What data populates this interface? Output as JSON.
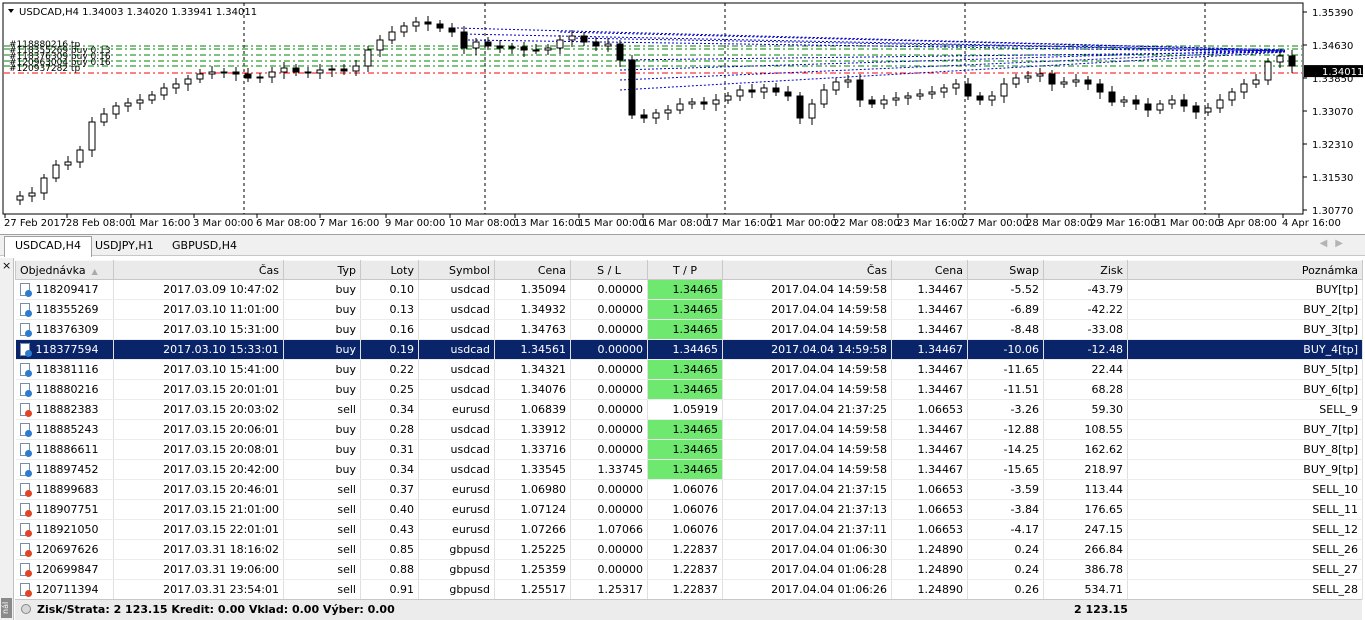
{
  "chart": {
    "header": "USDCAD,H4  1.34003 1.34020 1.33941 1.34011",
    "price_labels": [
      "1.35390",
      "1.34630",
      "1.33850",
      "1.33070",
      "1.32310",
      "1.31530",
      "1.30770"
    ],
    "current_price": "1.34011",
    "time_labels": [
      "27 Feb 2017",
      "28 Feb 08:00",
      "1 Mar 16:00",
      "3 Mar 00:00",
      "6 Mar 08:00",
      "7 Mar 16:00",
      "9 Mar 00:00",
      "10 Mar 08:00",
      "13 Mar 16:00",
      "15 Mar 00:00",
      "16 Mar 08:00",
      "17 Mar 16:00",
      "21 Mar 00:00",
      "22 Mar 08:00",
      "23 Mar 16:00",
      "27 Mar 00:00",
      "28 Mar 08:00",
      "29 Mar 16:00",
      "31 Mar 00:00",
      "3 Apr 08:00",
      "4 Apr 16:00"
    ],
    "order_labels": [
      "#118880216 tp",
      "#118355269 buy 0.13",
      "#118376309 buy 0.16",
      "#120963004 buy 0.16",
      "#120937282 tp"
    ],
    "colors": {
      "bull": "#ffffff",
      "bear": "#000000",
      "tp_line": "#008000",
      "entry_line": "#ff0000",
      "connector": "#0000cc",
      "grid": "#000000"
    }
  },
  "tabs": [
    {
      "label": "USDCAD,H4",
      "active": true
    },
    {
      "label": "USDJPY,H1",
      "active": false
    },
    {
      "label": "GBPUSD,H4",
      "active": false
    }
  ],
  "side": {
    "close": "×",
    "label": "nál"
  },
  "table": {
    "columns": [
      "Objednávka",
      "Čas",
      "Typ",
      "Loty",
      "Symbol",
      "Cena",
      "S / L",
      "T / P",
      "Čas",
      "Cena",
      "Swap",
      "Zisk",
      "Poznámka"
    ],
    "rows": [
      {
        "order": "118209417",
        "open_time": "2017.03.09 10:47:02",
        "type": "buy",
        "lots": "0.10",
        "symbol": "usdcad",
        "open_price": "1.35094",
        "sl": "0.00000",
        "tp": "1.34465",
        "close_time": "2017.04.04 14:59:58",
        "close_price": "1.34467",
        "swap": "-5.52",
        "profit": "-43.79",
        "comment": "BUY[tp]",
        "tp_hit": true,
        "selected": false
      },
      {
        "order": "118355269",
        "open_time": "2017.03.10 11:01:00",
        "type": "buy",
        "lots": "0.13",
        "symbol": "usdcad",
        "open_price": "1.34932",
        "sl": "0.00000",
        "tp": "1.34465",
        "close_time": "2017.04.04 14:59:58",
        "close_price": "1.34467",
        "swap": "-6.89",
        "profit": "-42.22",
        "comment": "BUY_2[tp]",
        "tp_hit": true,
        "selected": false
      },
      {
        "order": "118376309",
        "open_time": "2017.03.10 15:31:00",
        "type": "buy",
        "lots": "0.16",
        "symbol": "usdcad",
        "open_price": "1.34763",
        "sl": "0.00000",
        "tp": "1.34465",
        "close_time": "2017.04.04 14:59:58",
        "close_price": "1.34467",
        "swap": "-8.48",
        "profit": "-33.08",
        "comment": "BUY_3[tp]",
        "tp_hit": true,
        "selected": false
      },
      {
        "order": "118377594",
        "open_time": "2017.03.10 15:33:01",
        "type": "buy",
        "lots": "0.19",
        "symbol": "usdcad",
        "open_price": "1.34561",
        "sl": "0.00000",
        "tp": "1.34465",
        "close_time": "2017.04.04 14:59:58",
        "close_price": "1.34467",
        "swap": "-10.06",
        "profit": "-12.48",
        "comment": "BUY_4[tp]",
        "tp_hit": true,
        "selected": true
      },
      {
        "order": "118381116",
        "open_time": "2017.03.10 15:41:00",
        "type": "buy",
        "lots": "0.22",
        "symbol": "usdcad",
        "open_price": "1.34321",
        "sl": "0.00000",
        "tp": "1.34465",
        "close_time": "2017.04.04 14:59:58",
        "close_price": "1.34467",
        "swap": "-11.65",
        "profit": "22.44",
        "comment": "BUY_5[tp]",
        "tp_hit": true,
        "selected": false
      },
      {
        "order": "118880216",
        "open_time": "2017.03.15 20:01:01",
        "type": "buy",
        "lots": "0.25",
        "symbol": "usdcad",
        "open_price": "1.34076",
        "sl": "0.00000",
        "tp": "1.34465",
        "close_time": "2017.04.04 14:59:58",
        "close_price": "1.34467",
        "swap": "-11.51",
        "profit": "68.28",
        "comment": "BUY_6[tp]",
        "tp_hit": true,
        "selected": false
      },
      {
        "order": "118882383",
        "open_time": "2017.03.15 20:03:02",
        "type": "sell",
        "lots": "0.34",
        "symbol": "eurusd",
        "open_price": "1.06839",
        "sl": "0.00000",
        "tp": "1.05919",
        "close_time": "2017.04.04 21:37:25",
        "close_price": "1.06653",
        "swap": "-3.26",
        "profit": "59.30",
        "comment": "SELL_9",
        "tp_hit": false,
        "selected": false
      },
      {
        "order": "118885243",
        "open_time": "2017.03.15 20:06:01",
        "type": "buy",
        "lots": "0.28",
        "symbol": "usdcad",
        "open_price": "1.33912",
        "sl": "0.00000",
        "tp": "1.34465",
        "close_time": "2017.04.04 14:59:58",
        "close_price": "1.34467",
        "swap": "-12.88",
        "profit": "108.55",
        "comment": "BUY_7[tp]",
        "tp_hit": true,
        "selected": false
      },
      {
        "order": "118886611",
        "open_time": "2017.03.15 20:08:01",
        "type": "buy",
        "lots": "0.31",
        "symbol": "usdcad",
        "open_price": "1.33716",
        "sl": "0.00000",
        "tp": "1.34465",
        "close_time": "2017.04.04 14:59:58",
        "close_price": "1.34467",
        "swap": "-14.25",
        "profit": "162.62",
        "comment": "BUY_8[tp]",
        "tp_hit": true,
        "selected": false
      },
      {
        "order": "118897452",
        "open_time": "2017.03.15 20:42:00",
        "type": "buy",
        "lots": "0.34",
        "symbol": "usdcad",
        "open_price": "1.33545",
        "sl": "1.33745",
        "tp": "1.34465",
        "close_time": "2017.04.04 14:59:58",
        "close_price": "1.34467",
        "swap": "-15.65",
        "profit": "218.97",
        "comment": "BUY_9[tp]",
        "tp_hit": true,
        "selected": false
      },
      {
        "order": "118899683",
        "open_time": "2017.03.15 20:46:01",
        "type": "sell",
        "lots": "0.37",
        "symbol": "eurusd",
        "open_price": "1.06980",
        "sl": "0.00000",
        "tp": "1.06076",
        "close_time": "2017.04.04 21:37:15",
        "close_price": "1.06653",
        "swap": "-3.59",
        "profit": "113.44",
        "comment": "SELL_10",
        "tp_hit": false,
        "selected": false
      },
      {
        "order": "118907751",
        "open_time": "2017.03.15 21:01:00",
        "type": "sell",
        "lots": "0.40",
        "symbol": "eurusd",
        "open_price": "1.07124",
        "sl": "0.00000",
        "tp": "1.06076",
        "close_time": "2017.04.04 21:37:13",
        "close_price": "1.06653",
        "swap": "-3.84",
        "profit": "176.65",
        "comment": "SELL_11",
        "tp_hit": false,
        "selected": false
      },
      {
        "order": "118921050",
        "open_time": "2017.03.15 22:01:01",
        "type": "sell",
        "lots": "0.43",
        "symbol": "eurusd",
        "open_price": "1.07266",
        "sl": "1.07066",
        "tp": "1.06076",
        "close_time": "2017.04.04 21:37:11",
        "close_price": "1.06653",
        "swap": "-4.17",
        "profit": "247.15",
        "comment": "SELL_12",
        "tp_hit": false,
        "selected": false
      },
      {
        "order": "120697626",
        "open_time": "2017.03.31 18:16:02",
        "type": "sell",
        "lots": "0.85",
        "symbol": "gbpusd",
        "open_price": "1.25225",
        "sl": "0.00000",
        "tp": "1.22837",
        "close_time": "2017.04.04 01:06:30",
        "close_price": "1.24890",
        "swap": "0.24",
        "profit": "266.84",
        "comment": "SELL_26",
        "tp_hit": false,
        "selected": false
      },
      {
        "order": "120699847",
        "open_time": "2017.03.31 19:06:00",
        "type": "sell",
        "lots": "0.88",
        "symbol": "gbpusd",
        "open_price": "1.25359",
        "sl": "0.00000",
        "tp": "1.22837",
        "close_time": "2017.04.04 01:06:28",
        "close_price": "1.24890",
        "swap": "0.24",
        "profit": "386.78",
        "comment": "SELL_27",
        "tp_hit": false,
        "selected": false
      },
      {
        "order": "120711394",
        "open_time": "2017.03.31 23:54:01",
        "type": "sell",
        "lots": "0.91",
        "symbol": "gbpusd",
        "open_price": "1.25517",
        "sl": "1.25317",
        "tp": "1.22837",
        "close_time": "2017.04.04 01:06:26",
        "close_price": "1.24890",
        "swap": "0.26",
        "profit": "534.71",
        "comment": "SELL_28",
        "tp_hit": false,
        "selected": false
      }
    ]
  },
  "footer": {
    "summary": "Zisk/Strata: 2 123.15  Kredit: 0.00  Vklad: 0.00  Výber: 0.00",
    "total": "2 123.15"
  }
}
